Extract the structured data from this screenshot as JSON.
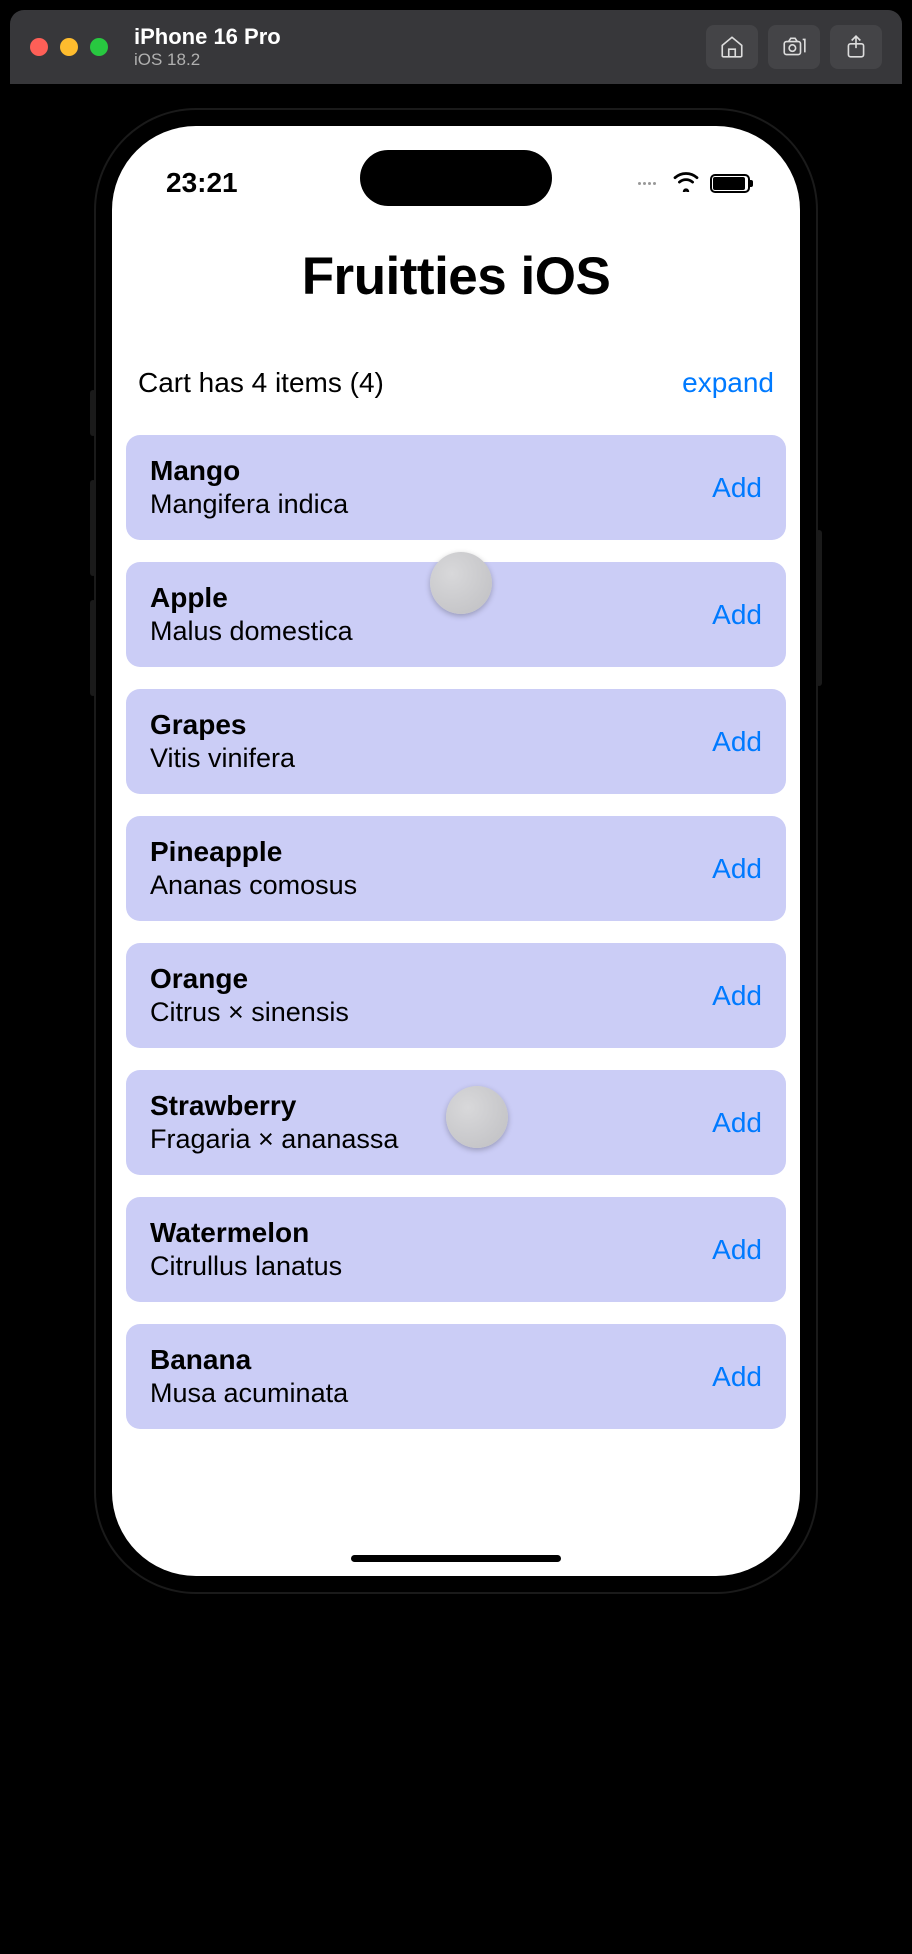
{
  "simulator": {
    "device": "iPhone 16 Pro",
    "os": "iOS 18.2"
  },
  "status": {
    "time": "23:21"
  },
  "app": {
    "title": "Fruitties iOS",
    "cart_text": "Cart has 4 items (4)",
    "expand_label": "expand",
    "add_label": "Add"
  },
  "fruits": [
    {
      "name": "Mango",
      "latin": "Mangifera indica"
    },
    {
      "name": "Apple",
      "latin": "Malus domestica"
    },
    {
      "name": "Grapes",
      "latin": "Vitis vinifera"
    },
    {
      "name": "Pineapple",
      "latin": "Ananas comosus"
    },
    {
      "name": "Orange",
      "latin": "Citrus × sinensis"
    },
    {
      "name": "Strawberry",
      "latin": "Fragaria × ananassa"
    },
    {
      "name": "Watermelon",
      "latin": "Citrullus lanatus"
    },
    {
      "name": "Banana",
      "latin": "Musa acuminata"
    }
  ]
}
